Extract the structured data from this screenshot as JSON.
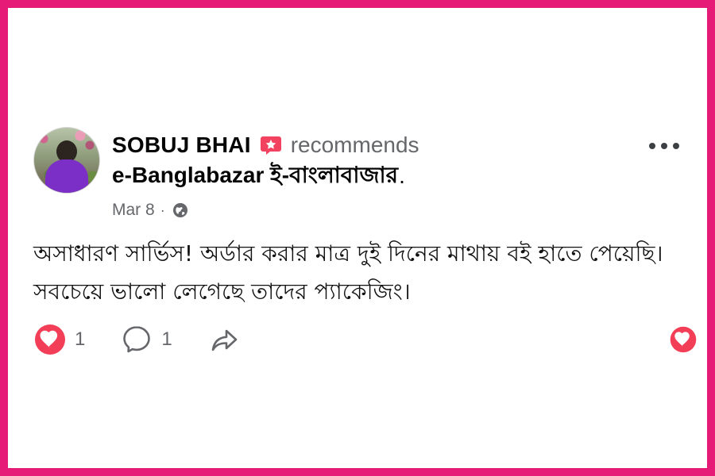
{
  "post": {
    "author": {
      "name": "SOBUJ BHAI",
      "recommendation_text": "recommends"
    },
    "page": {
      "name": "e-Banglabazar ই-বাংলাবাজার",
      "suffix": "."
    },
    "date": "Mar 8",
    "separator": "·",
    "privacy_icon": "globe-icon",
    "content": "অসাধারণ সার্ভিস! অর্ডার করার মাত্র দুই দিনের মাথায় বই হাতে পেয়েছি। সবচেয়ে ভালো লেগেছে তাদের প্যাকেজিং।",
    "more_icon": "more-options-icon"
  },
  "actions": {
    "reaction_count": "1",
    "comment_count": "1",
    "share_icon": "share-icon",
    "like_icon": "heart-icon"
  },
  "colors": {
    "frame": "#e61b78",
    "heart": "#f33e58",
    "secondary_text": "#65676b",
    "recommend_badge": "#f3425f"
  }
}
